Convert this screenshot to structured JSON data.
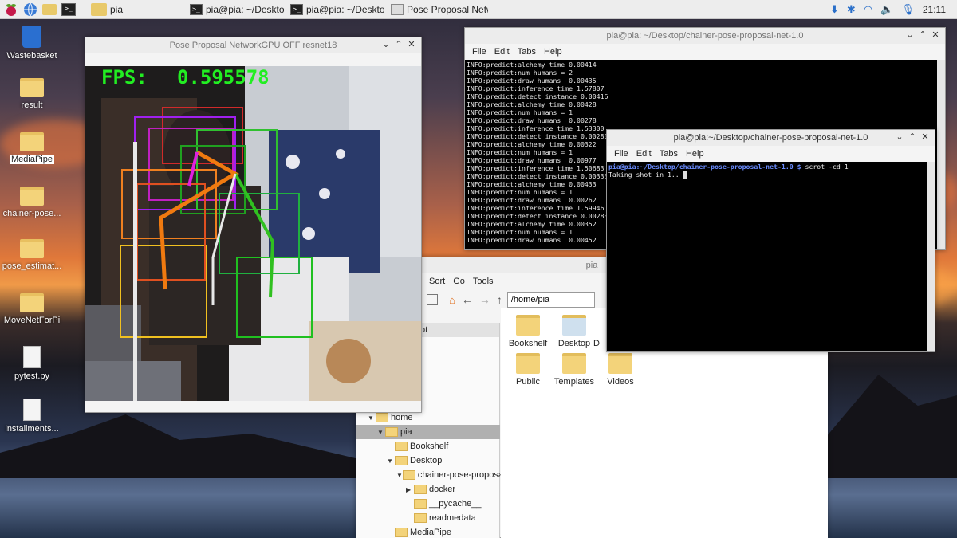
{
  "taskbar": {
    "buttons": [
      {
        "label": "pia"
      },
      {
        "label": "pia@pia: ~/Desktop/..."
      },
      {
        "label": "pia@pia: ~/Desktop/..."
      },
      {
        "label": "Pose Proposal Netwo..."
      }
    ],
    "clock": "21:11"
  },
  "desktop": {
    "icons": [
      "Wastebasket",
      "result",
      "MediaPipe",
      "chainer-pose...",
      "pose_estimat...",
      "MoveNetForPi",
      "pytest.py",
      "installments..."
    ]
  },
  "pose_window": {
    "title": "Pose Proposal NetworkGPU OFF resnet18",
    "fps_label": "FPS:",
    "fps_value": "0.595578"
  },
  "terminal_back": {
    "title": "pia@pia: ~/Desktop/chainer-pose-proposal-net-1.0",
    "menu": [
      "File",
      "Edit",
      "Tabs",
      "Help"
    ],
    "lines": [
      "INFO:predict:alchemy time 0.00414",
      "INFO:predict:num humans = 2",
      "INFO:predict:draw humans  0.00435",
      "INFO:predict:inference time 1.57807",
      "INFO:predict:detect instance 0.00416",
      "INFO:predict:alchemy time 0.00428",
      "INFO:predict:num humans = 1",
      "INFO:predict:draw humans  0.00278",
      "INFO:predict:inference time 1.53300",
      "INFO:predict:detect instance 0.00280",
      "INFO:predict:alchemy time 0.00322",
      "INFO:predict:num humans = 1",
      "INFO:predict:draw humans  0.00977",
      "INFO:predict:inference time 1.50683",
      "INFO:predict:detect instance 0.00333",
      "INFO:predict:alchemy time 0.00433",
      "INFO:predict:num humans = 1",
      "INFO:predict:draw humans  0.00262",
      "INFO:predict:inference time 1.59946",
      "INFO:predict:detect instance 0.00283",
      "INFO:predict:alchemy time 0.00352",
      "INFO:predict:num humans = 1",
      "INFO:predict:draw humans  0.00452"
    ]
  },
  "terminal_front": {
    "title": "pia@pia:~/Desktop/chainer-pose-proposal-net-1.0",
    "menu": [
      "File",
      "Edit",
      "Tabs",
      "Help"
    ],
    "prompt": "pia@pia:~/Desktop/chainer-pose-proposal-net-1.0 $",
    "command": " scrot -cd 1",
    "output": "Taking shot in 1.. "
  },
  "file_manager": {
    "title": "pia",
    "menu": [
      "Sort",
      "Go",
      "Tools"
    ],
    "path": "/home/pia",
    "side_partial": "ot",
    "tree": [
      {
        "label": "home",
        "level": 0,
        "arrow": "▼",
        "selected": false
      },
      {
        "label": "pia",
        "level": 1,
        "arrow": "▼",
        "selected": true
      },
      {
        "label": "Bookshelf",
        "level": 2,
        "arrow": "",
        "selected": false
      },
      {
        "label": "Desktop",
        "level": 2,
        "arrow": "▼",
        "selected": false
      },
      {
        "label": "chainer-pose-proposal-n",
        "level": 3,
        "arrow": "▼",
        "selected": false
      },
      {
        "label": "docker",
        "level": 4,
        "arrow": "▶",
        "selected": false
      },
      {
        "label": "__pycache__",
        "level": 4,
        "arrow": "",
        "selected": false
      },
      {
        "label": "readmedata",
        "level": 4,
        "arrow": "",
        "selected": false
      },
      {
        "label": "MediaPipe",
        "level": 2,
        "arrow": "",
        "selected": false
      }
    ],
    "items": [
      "Bookshelf",
      "Desktop",
      "D",
      "Public",
      "Templates",
      "Videos"
    ]
  }
}
